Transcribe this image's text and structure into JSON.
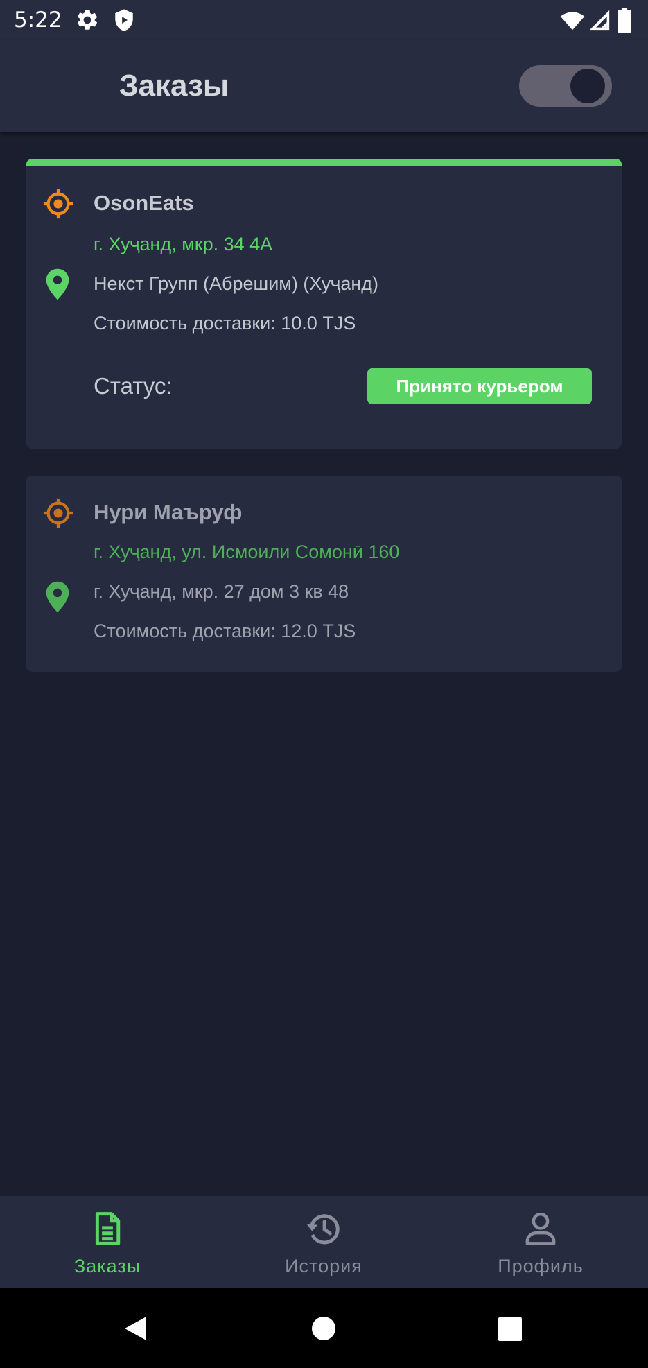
{
  "status_bar": {
    "time": "5:22",
    "icons": [
      "gear-icon",
      "shield-icon",
      "wifi-icon",
      "signal-icon",
      "battery-icon"
    ]
  },
  "header": {
    "title": "Заказы",
    "toggle_state": "on"
  },
  "orders": [
    {
      "name": "OsonEats",
      "pickup": "г. Хуҷанд, мкр. 34 4А",
      "destination": "Некст Групп (Абрешим) (Хуҷанд)",
      "cost": "Стоимость доставки:  10.0 TJS",
      "status_label": "Статус:",
      "status_value": "Принято курьером"
    },
    {
      "name": "Нури Маъруф",
      "pickup": "г. Хуҷанд, ул. Исмоили Сомонӣ 160",
      "destination": "г. Хуҷанд, мкр. 27 дом 3 кв 48",
      "cost": "Стоимость доставки: 12.0 TJS"
    }
  ],
  "bottom_nav": {
    "items": [
      {
        "label": "Заказы",
        "icon": "document-icon",
        "active": true
      },
      {
        "label": "История",
        "icon": "history-icon",
        "active": false
      },
      {
        "label": "Профиль",
        "icon": "profile-icon",
        "active": false
      }
    ]
  },
  "system_nav": {
    "buttons": [
      "back-icon",
      "home-icon",
      "recents-icon"
    ]
  },
  "colors": {
    "background": "#1a1e2f",
    "surface": "#262b40",
    "accent_green": "#5bd365",
    "pickup_orange": "#f08a1d"
  }
}
